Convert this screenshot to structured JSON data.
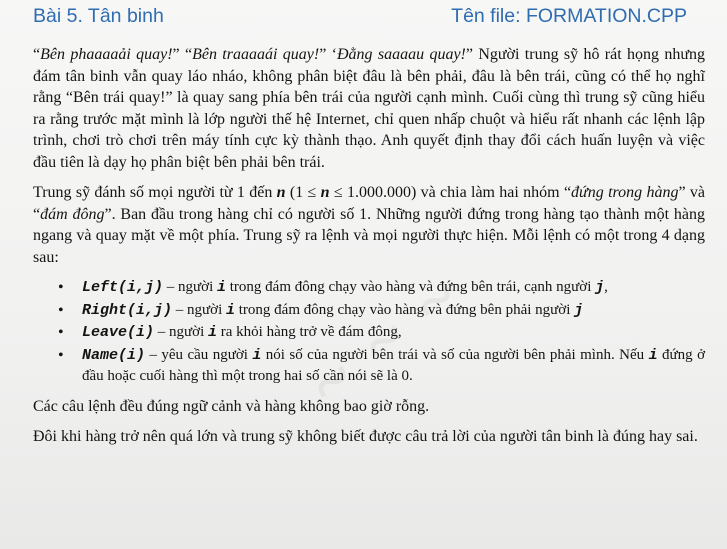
{
  "header": {
    "title": "Bài 5. Tân binh",
    "filename": "Tên file: FORMATION.CPP"
  },
  "para1": {
    "q1": "Bên phaaaaải quay!",
    "q2": "Bên traaaaái quay!",
    "q3": "Đằng saaaau quay!",
    "rest": " Người trung sỹ hô rát họng nhưng đám tân binh vẫn quay láo nháo, không phân biệt đâu là bên phải, đâu là bên trái, cũng có thể họ nghĩ rằng “Bên trái quay!” là quay sang phía bên trái của người cạnh mình. Cuối cùng thì trung sỹ cũng hiểu ra rằng trước mặt mình là lớp người thế hệ Internet, chỉ quen nhấp chuột và hiểu rất nhanh các lệnh lập trình, chơi trò chơi trên máy tính cực kỳ thành thạo. Anh quyết định thay đổi cách huấn luyện và việc đầu tiên là dạy họ phân biệt bên phải bên trái."
  },
  "para2": {
    "a": "Trung sỹ đánh số mọi người từ 1 đến ",
    "n1": "n",
    "b": " (1 ≤ ",
    "n2": "n",
    "c": " ≤ 1.000.000) và chia làm hai nhóm “",
    "g1": "đứng trong hàng",
    "d": "” và “",
    "g2": "đám đông",
    "e": "”. Ban đầu trong hàng chỉ có người số 1. Những người đứng trong hàng tạo thành một hàng ngang và quay mặt về một phía. Trung sỹ ra lệnh và mọi người thực hiện. Mỗi lệnh có một trong 4 dạng sau:"
  },
  "commands": [
    {
      "code": "Left(i,j)",
      "pre": " – người ",
      "v1": "i",
      "mid": " trong đám đông chạy vào hàng và đứng bên trái, cạnh người ",
      "v2": "j",
      "post": ","
    },
    {
      "code": "Right(i,j)",
      "pre": "  –  người ",
      "v1": "i",
      "mid": " trong đám đông chạy vào hàng và đứng bên phải người ",
      "v2": "j",
      "post": ""
    },
    {
      "code": "Leave(i)",
      "pre": " – người ",
      "v1": "i",
      "mid": " ra khỏi hàng trở về đám đông,",
      "v2": "",
      "post": ""
    },
    {
      "code": "Name(i)",
      "pre": " – yêu cầu người ",
      "v1": "i",
      "mid": " nói số của người bên trái và số của người bên phải mình. Nếu ",
      "v2": "i",
      "post": " đứng ở đầu hoặc cuối hàng thì một trong hai số cần nói sẽ là 0."
    }
  ],
  "para3": "Các câu lệnh đều đúng ngữ cảnh và hàng không bao giờ rỗng.",
  "para4": "Đôi khi hàng trở nên quá lớn và trung sỹ không biết được câu trả lời của người tân binh là đúng hay sai.",
  "bullet": "•"
}
